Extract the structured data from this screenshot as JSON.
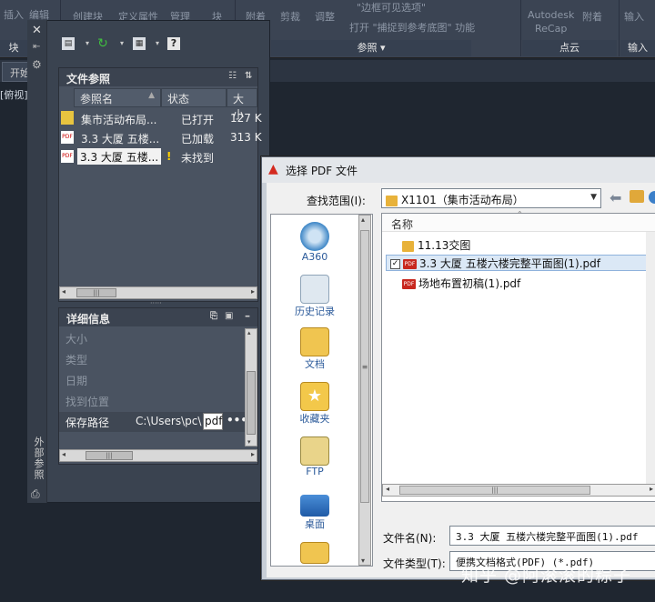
{
  "ribbon": {
    "top_items": [
      "插入",
      "编辑",
      "创建块",
      "定义属性",
      "管理",
      "块",
      "附着",
      "剪裁",
      "调整",
      "\"边框可见选项\"",
      "打开 \"捕捉到参考底图\" 功能",
      "Autodesk",
      "附着",
      "输入"
    ],
    "recap": "ReCap",
    "panels": [
      "块",
      "参照 ▾",
      "点云",
      "输入"
    ]
  },
  "doc_tab": "开始",
  "view_label": "[俯视]",
  "palette": {
    "strip_label": "外部参照",
    "refs_section": {
      "title": "文件参照",
      "columns": [
        "参照名",
        "状态",
        "大小"
      ],
      "rows": [
        {
          "name": "集市活动布局...",
          "status": "已打开",
          "size": "127 K",
          "icon": "dwg"
        },
        {
          "name": "3.3 大厦 五楼...",
          "status": "已加载",
          "size": "313 K",
          "icon": "pdf"
        },
        {
          "name": "3.3 大厦 五楼...",
          "status": "未找到",
          "size": "",
          "icon": "pdf",
          "warn": "!"
        }
      ]
    },
    "details_section": {
      "title": "详细信息",
      "rows": [
        "大小",
        "类型",
        "日期",
        "找到位置"
      ],
      "saved_path_label": "保存路径",
      "saved_path_value": "C:\\Users\\pc\\",
      "saved_path_input": "pdf",
      "browse": "•••"
    },
    "scroll_grip": "|||"
  },
  "dialog": {
    "title": "选择 PDF 文件",
    "lookin_label": "查找范围(I):",
    "lookin_value": "X1101（集市活动布局）",
    "places": [
      "A360",
      "历史记录",
      "文档",
      "收藏夹",
      "FTP",
      "桌面"
    ],
    "column_name": "名称",
    "files": [
      {
        "name": "11.13交图",
        "type": "folder"
      },
      {
        "name": "3.3 大厦 五楼六楼完整平面图(1).pdf",
        "type": "pdf",
        "selected": true
      },
      {
        "name": "场地布置初稿(1).pdf",
        "type": "pdf"
      }
    ],
    "filename_label": "文件名(N):",
    "filename_value": "3.3 大厦 五楼六楼完整平面图(1).pdf",
    "filetype_label": "文件类型(T):",
    "filetype_value": "便携文档格式(PDF) (*.pdf)",
    "scroll_grip": "|||"
  },
  "watermark": "知乎 @阿滚滚的粽子"
}
